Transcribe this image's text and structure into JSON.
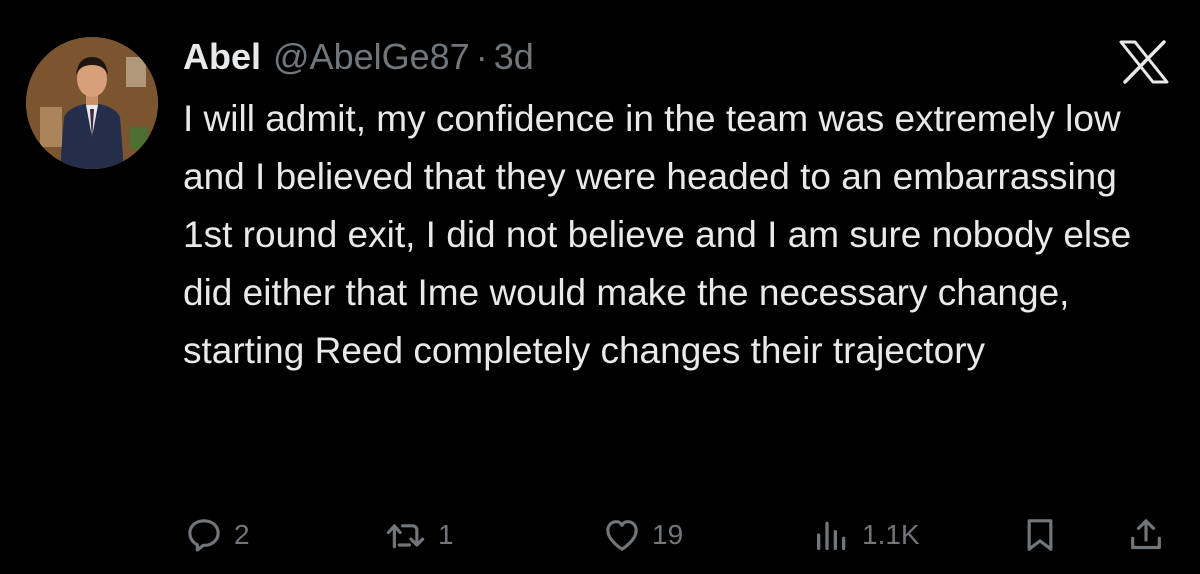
{
  "author": {
    "name": "Abel",
    "handle": "@AbelGe87",
    "separator": "·",
    "time": "3d"
  },
  "tweet": {
    "text": "I will admit, my confidence in the team was extremely low and I believed that they were headed to an embarrassing 1st round exit, I did not believe and I am sure nobody else did either that Ime would make the necessary change, starting Reed completely changes their trajectory"
  },
  "actions": {
    "replies": "2",
    "retweets": "1",
    "likes": "19",
    "views": "1.1K"
  },
  "icons": {
    "reply": "reply-icon",
    "retweet": "retweet-icon",
    "like": "heart-icon",
    "views": "views-icon",
    "bookmark": "bookmark-icon",
    "share": "share-icon",
    "logo": "x-logo-icon"
  },
  "colors": {
    "background": "#000000",
    "text": "#e7e9ea",
    "secondary": "#71767b"
  }
}
